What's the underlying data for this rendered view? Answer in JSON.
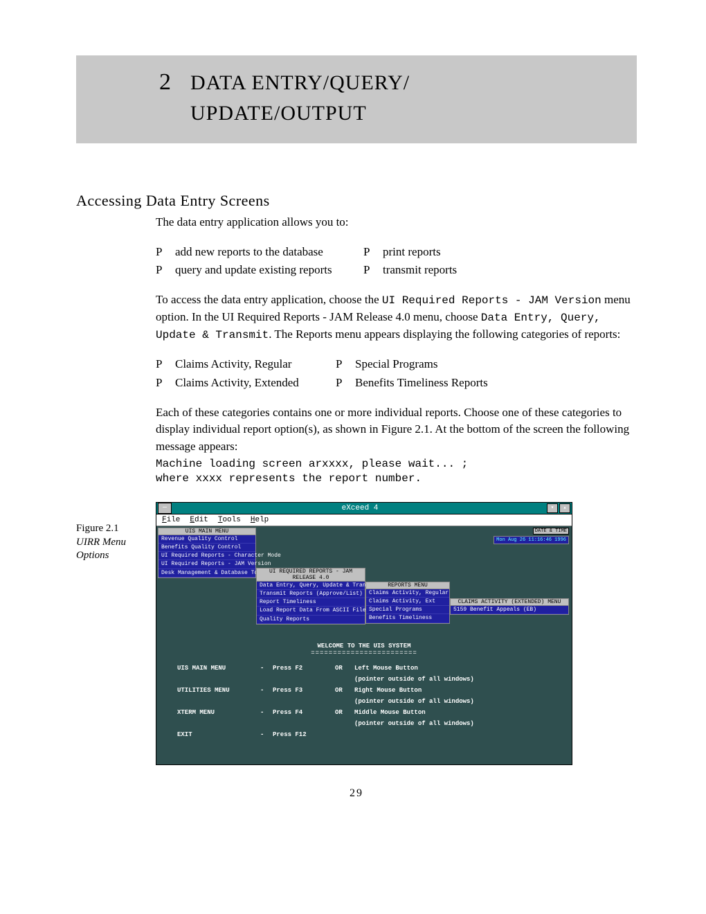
{
  "chapter": {
    "number": "2",
    "title": "DATA ENTRY/QUERY/\nUPDATE/OUTPUT"
  },
  "section_heading": "Accessing Data Entry Screens",
  "intro": "The data entry application allows you to:",
  "capabilities": {
    "left": [
      "add new reports to the database",
      "query and update existing reports"
    ],
    "right": [
      "print reports",
      "transmit reports"
    ]
  },
  "access_para": {
    "t1": "To access the data entry application, choose the ",
    "code1": "UI Required Reports - JAM Version",
    "t2": " menu option.  In the UI Required Reports - JAM Release 4.0 menu, choose ",
    "code2": "Data Entry, Query, Update & Transmit",
    "t3": ".  The Reports menu appears displaying the following categories of reports:"
  },
  "categories": {
    "left": [
      "Claims Activity, Regular",
      "Claims Activity, Extended"
    ],
    "right": [
      "Special Programs",
      "Benefits Timeliness Reports"
    ]
  },
  "category_para": "Each of these categories contains one or more individual reports.  Choose one of these categories to display individual report option(s), as shown in Figure 2.1.  At the bottom of the screen the following message appears:",
  "code_block": "Machine loading screen arxxxx, please wait... ;\nwhere xxxx represents the report number.",
  "figure": {
    "label": "Figure 2.1",
    "caption": "UIRR Menu Options"
  },
  "screenshot": {
    "title": "eXceed 4",
    "menubar": [
      "File",
      "Edit",
      "Tools",
      "Help"
    ],
    "datetime_label": "DATE & TIME",
    "datetime_value": "Mon Aug 26 11:16:46 1996",
    "main_menu": {
      "title": "UIS MAIN MENU",
      "items": [
        "Revenue Quality Control",
        "Benefits Quality Control",
        "UI Required Reports - Character Mode",
        "UI Required Reports - JAM Version",
        "Desk Management & Database Tools"
      ]
    },
    "ui_menu": {
      "title": "UI REQUIRED REPORTS - JAM RELEASE 4.0",
      "items": [
        "Data Entry, Query, Update & Transmit",
        "Transmit Reports (Approve/List)",
        "Report Timeliness",
        "Load Report Data From ASCII File",
        "Quality Reports"
      ]
    },
    "reports_menu": {
      "title": "REPORTS MENU",
      "items": [
        "Claims Activity, Regular",
        "Claims Activity, Ext",
        "Special Programs",
        "Benefits Timeliness"
      ]
    },
    "claims_ext_menu": {
      "title": "CLAIMS ACTIVITY (EXTENDED) MENU",
      "items": [
        "5159 Benefit Appeals (EB)"
      ]
    },
    "welcome": {
      "title": "WELCOME TO THE UIS SYSTEM",
      "underline": "========================",
      "rows": [
        {
          "label": "UIS MAIN MENU",
          "dash": "-",
          "key": "Press F2",
          "or": "OR",
          "action": "Left Mouse Button",
          "sub": "(pointer outside of all windows)"
        },
        {
          "label": "UTILITIES MENU",
          "dash": "-",
          "key": "Press F3",
          "or": "OR",
          "action": "Right Mouse Button",
          "sub": "(pointer outside of all windows)"
        },
        {
          "label": "XTERM MENU",
          "dash": "-",
          "key": "Press F4",
          "or": "OR",
          "action": "Middle Mouse Button",
          "sub": "(pointer outside of all windows)"
        },
        {
          "label": "EXIT",
          "dash": "-",
          "key": "Press F12",
          "or": "",
          "action": "",
          "sub": ""
        }
      ]
    }
  },
  "bullet_char": "P",
  "page_number": "29"
}
